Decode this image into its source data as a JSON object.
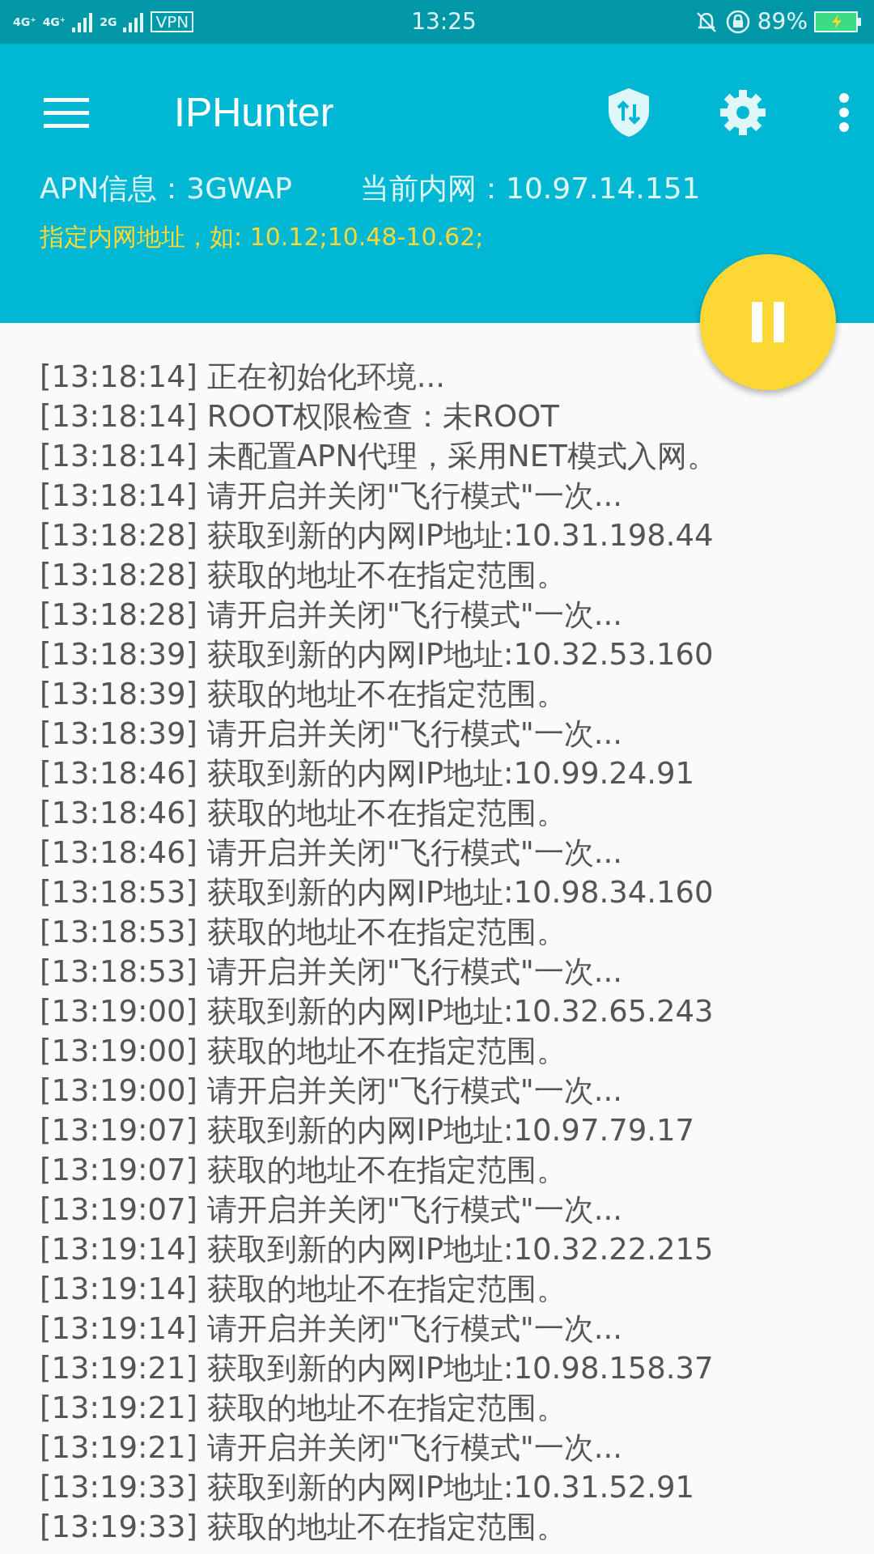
{
  "status_bar": {
    "network_1": "4G⁺",
    "network_2": "4G⁺",
    "network_3": "2G",
    "vpn": "VPN",
    "time": "13:25",
    "battery": "89%"
  },
  "toolbar": {
    "title": "IPHunter"
  },
  "info": {
    "apn": "APN信息：3GWAP",
    "intranet": "当前内网：10.97.14.151"
  },
  "range_field": {
    "placeholder": "指定内网地址，如: 10.12;10.48-10.62;"
  },
  "fab": {
    "running": true
  },
  "log": [
    "[13:18:14] 正在初始化环境...",
    "[13:18:14] ROOT权限检查：未ROOT",
    "[13:18:14] 未配置APN代理，采用NET模式入网。",
    "[13:18:14] 请开启并关闭\"飞行模式\"一次...",
    "[13:18:28] 获取到新的内网IP地址:10.31.198.44",
    "[13:18:28] 获取的地址不在指定范围。",
    "[13:18:28] 请开启并关闭\"飞行模式\"一次...",
    "[13:18:39] 获取到新的内网IP地址:10.32.53.160",
    "[13:18:39] 获取的地址不在指定范围。",
    "[13:18:39] 请开启并关闭\"飞行模式\"一次...",
    "[13:18:46] 获取到新的内网IP地址:10.99.24.91",
    "[13:18:46] 获取的地址不在指定范围。",
    "[13:18:46] 请开启并关闭\"飞行模式\"一次...",
    "[13:18:53] 获取到新的内网IP地址:10.98.34.160",
    "[13:18:53] 获取的地址不在指定范围。",
    "[13:18:53] 请开启并关闭\"飞行模式\"一次...",
    "[13:19:00] 获取到新的内网IP地址:10.32.65.243",
    "[13:19:00] 获取的地址不在指定范围。",
    "[13:19:00] 请开启并关闭\"飞行模式\"一次...",
    "[13:19:07] 获取到新的内网IP地址:10.97.79.17",
    "[13:19:07] 获取的地址不在指定范围。",
    "[13:19:07] 请开启并关闭\"飞行模式\"一次...",
    "[13:19:14] 获取到新的内网IP地址:10.32.22.215",
    "[13:19:14] 获取的地址不在指定范围。",
    "[13:19:14] 请开启并关闭\"飞行模式\"一次...",
    "[13:19:21] 获取到新的内网IP地址:10.98.158.37",
    "[13:19:21] 获取的地址不在指定范围。",
    "[13:19:21] 请开启并关闭\"飞行模式\"一次...",
    "[13:19:33] 获取到新的内网IP地址:10.31.52.91",
    "[13:19:33] 获取的地址不在指定范围。"
  ]
}
